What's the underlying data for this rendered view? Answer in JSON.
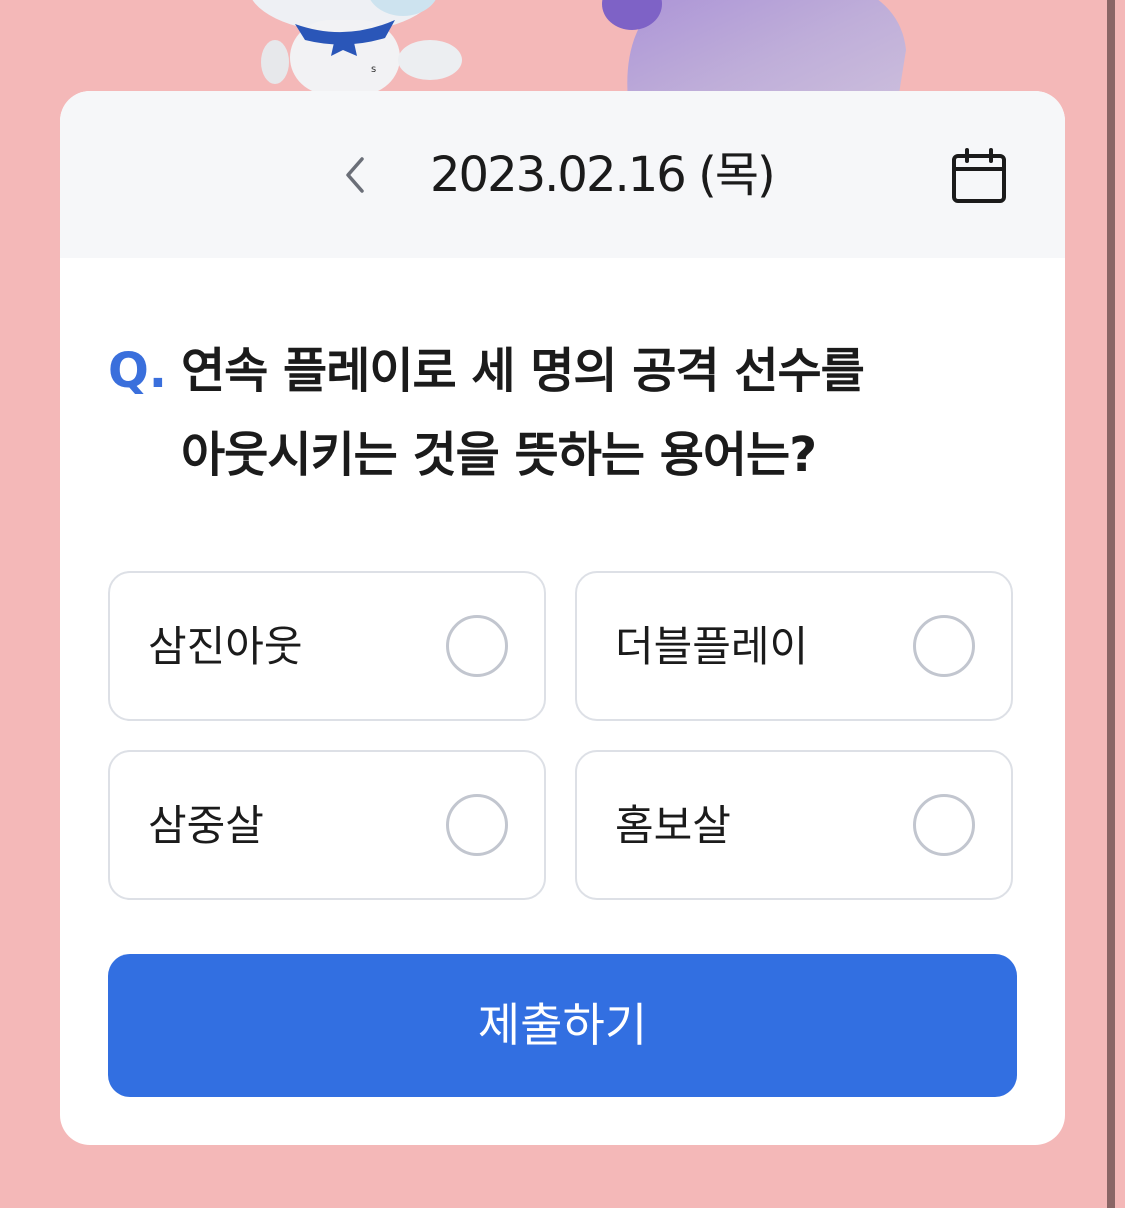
{
  "header": {
    "date": "2023.02.16 (목)",
    "prev_icon": "chevron-left-icon",
    "calendar_icon": "calendar-icon"
  },
  "quiz": {
    "q_mark": "Q.",
    "question": "연속 플레이로 세 명의 공격 선수를 아웃시키는 것을 뜻하는 용어는?",
    "options": [
      {
        "label": "삼진아웃",
        "selected": false
      },
      {
        "label": "더블플레이",
        "selected": false
      },
      {
        "label": "삼중살",
        "selected": false
      },
      {
        "label": "홈보살",
        "selected": false
      }
    ]
  },
  "submit": {
    "label": "제출하기"
  },
  "colors": {
    "background": "#f4b8b8",
    "accent": "#326fe1",
    "q_mark": "#3a6fdc"
  }
}
